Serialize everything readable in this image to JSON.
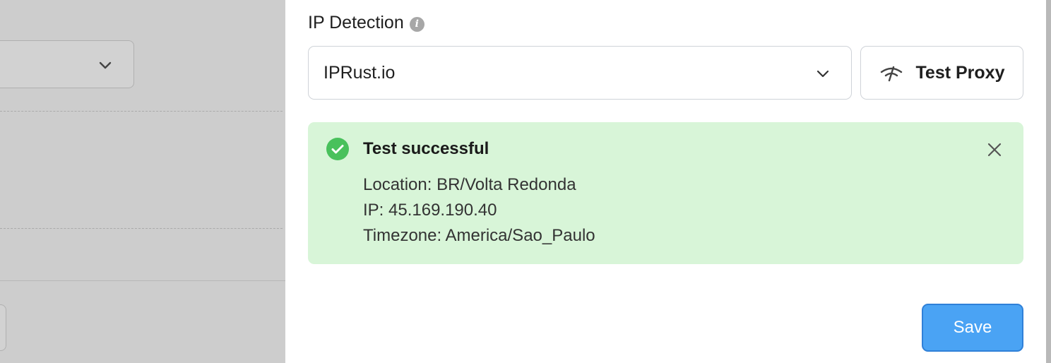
{
  "ip_detection": {
    "label": "IP Detection",
    "info_icon": "info-icon",
    "selected_service": "IPRust.io",
    "select_icon": "chevron-down-icon"
  },
  "test_proxy": {
    "label": "Test Proxy",
    "icon": "wifi-signal-icon"
  },
  "result": {
    "title": "Test successful",
    "icon": "check-circle-icon",
    "close_icon": "close-icon",
    "location": "Location: BR/Volta Redonda",
    "ip": "IP: 45.169.190.40",
    "timezone": "Timezone: America/Sao_Paulo",
    "background_color": "#d8f5d8",
    "status_color": "#49c15c"
  },
  "footer": {
    "save_label": "Save",
    "accent_color": "#4aa3f4"
  }
}
